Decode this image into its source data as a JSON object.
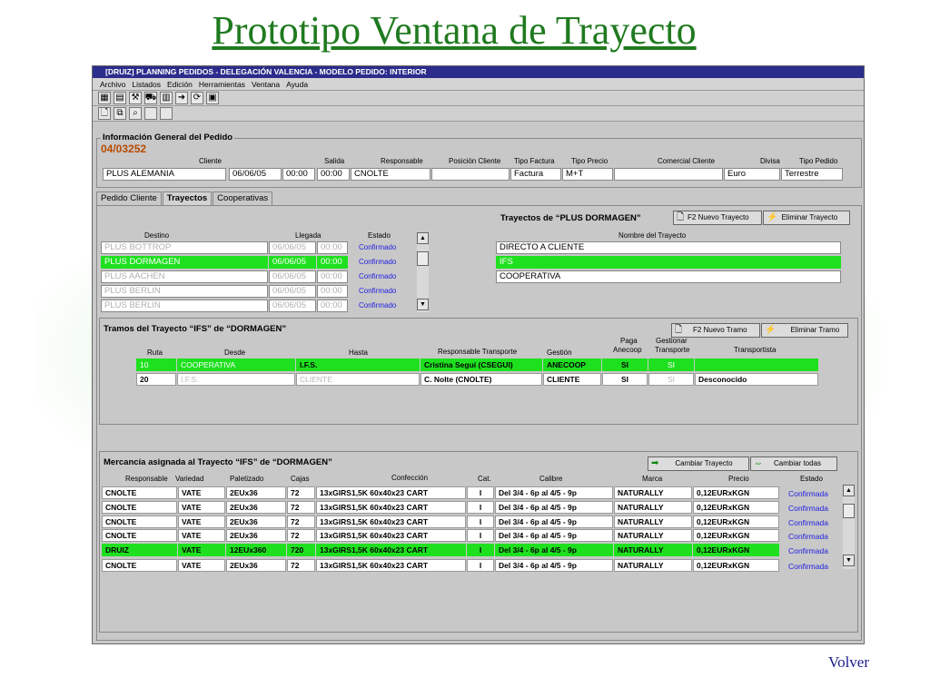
{
  "slide_title": "Prototipo Ventana de Trayecto",
  "volver": "Volver",
  "window": {
    "title": "[DRUIZ] PLANNING PEDIDOS - DELEGACIÓN VALENCIA - MODELO PEDIDO: INTERIOR",
    "menu": [
      "Archivo",
      "Listados",
      "Edición",
      "Herramientas",
      "Ventana",
      "Ayuda"
    ]
  },
  "info": {
    "title": "Información General del Pedido",
    "pedido": "04/03252",
    "headers": {
      "cliente": "Cliente",
      "salida": "Salida",
      "responsable": "Responsable",
      "posicion": "Posición Cliente",
      "tipo_factura": "Tipo Factura",
      "tipo_precio": "Tipo Precio",
      "comercial": "Comercial Cliente",
      "divisa": "Divisa",
      "tipo_pedido": "Tipo Pedido"
    },
    "values": {
      "cliente": "PLUS ALEMANIA",
      "fecha": "06/06/05",
      "hora1": "00:00",
      "hora2": "00:00",
      "responsable": "CNOLTE",
      "posicion": "",
      "tipo_factura": "Factura",
      "tipo_precio": "M+T",
      "comercial": "",
      "divisa": "Euro",
      "tipo_pedido": "Terrestre"
    }
  },
  "tabs": [
    "Pedido Cliente",
    "Trayectos",
    "Cooperativas"
  ],
  "destinos": {
    "headers": {
      "destino": "Destino",
      "llegada": "Llegada",
      "estado": "Estado"
    },
    "rows": [
      {
        "destino": "PLUS BOTTROP",
        "fecha": "06/06/05",
        "hora": "00:00",
        "estado": "Confirmado"
      },
      {
        "destino": "PLUS DORMAGEN",
        "fecha": "06/06/05",
        "hora": "00:00",
        "estado": "Confirmado"
      },
      {
        "destino": "PLUS AACHEN",
        "fecha": "06/06/05",
        "hora": "00:00",
        "estado": "Confirmado"
      },
      {
        "destino": "PLUS BERLIN",
        "fecha": "06/06/05",
        "hora": "00:00",
        "estado": "Confirmado"
      },
      {
        "destino": "PLUS BERLIN",
        "fecha": "06/06/05",
        "hora": "00:00",
        "estado": "Confirmado"
      }
    ]
  },
  "trayectos": {
    "title": "Trayectos de “PLUS DORMAGEN”",
    "nuevo": "F2 Nuevo Trayecto",
    "eliminar": "Eliminar Trayecto",
    "header": "Nombre del Trayecto",
    "rows": [
      "DIRECTO A CLIENTE",
      "IFS",
      "COOPERATIVA"
    ]
  },
  "tramos": {
    "title": "Tramos del Trayecto “IFS” de “DORMAGEN”",
    "nuevo": "F2 Nuevo Tramo",
    "eliminar": "Eliminar Tramo",
    "headers": {
      "ruta": "Ruta",
      "desde": "Desde",
      "hasta": "Hasta",
      "resp": "Responsable Transporte",
      "gestion": "Gestión",
      "paga1": "Paga",
      "paga2": "Anecoop",
      "gest1": "Gestionar",
      "gest2": "Transporte",
      "transportista": "Transportista"
    },
    "rows": [
      {
        "ruta": "10",
        "desde": "COOPERATIVA",
        "hasta": "I.F.S.",
        "resp": "Cristina Seguí (CSEGUI)",
        "gestion": "ANECOOP",
        "paga": "SI",
        "gestionar": "SI",
        "transportista": ""
      },
      {
        "ruta": "20",
        "desde": "I.F.S.",
        "hasta": "CLIENTE",
        "resp": "C. Nolte (CNOLTE)",
        "gestion": "CLIENTE",
        "paga": "SI",
        "gestionar": "SI",
        "transportista": "Desconocido"
      }
    ]
  },
  "mercancia": {
    "title": "Mercancía asignada al Trayecto “IFS”  de “DORMAGEN”",
    "cambiar": "Cambiar Trayecto",
    "cambiar_todas": "Cambiar todas",
    "headers": {
      "resp": "Responsable",
      "variedad": "Variedad",
      "paletizado": "Paletizado",
      "cajas": "Cajas",
      "confeccion": "Confección",
      "cat": "Cat.",
      "calibre": "Calibre",
      "marca": "Marca",
      "precio": "Precio",
      "estado": "Estado"
    },
    "rows": [
      {
        "resp": "CNOLTE",
        "variedad": "VATE",
        "paletizado": "2EUx36",
        "cajas": "72",
        "confeccion": "13xGIRS1,5K 60x40x23 CART",
        "cat": "I",
        "calibre": "Del 3/4 - 6p al 4/5 - 9p",
        "marca": "NATURALLY",
        "precio": "0,12EURxKGN",
        "estado": "Confirmada"
      },
      {
        "resp": "CNOLTE",
        "variedad": "VATE",
        "paletizado": "2EUx36",
        "cajas": "72",
        "confeccion": "13xGIRS1,5K 60x40x23 CART",
        "cat": "I",
        "calibre": "Del 3/4 - 6p al 4/5 - 9p",
        "marca": "NATURALLY",
        "precio": "0,12EURxKGN",
        "estado": "Confirmada"
      },
      {
        "resp": "CNOLTE",
        "variedad": "VATE",
        "paletizado": "2EUx36",
        "cajas": "72",
        "confeccion": "13xGIRS1,5K 60x40x23 CART",
        "cat": "I",
        "calibre": "Del 3/4 - 6p al 4/5 - 9p",
        "marca": "NATURALLY",
        "precio": "0,12EURxKGN",
        "estado": "Confirmada"
      },
      {
        "resp": "CNOLTE",
        "variedad": "VATE",
        "paletizado": "2EUx36",
        "cajas": "72",
        "confeccion": "13xGIRS1,5K 60x40x23 CART",
        "cat": "I",
        "calibre": "Del 3/4 - 6p al 4/5 - 9p",
        "marca": "NATURALLY",
        "precio": "0,12EURxKGN",
        "estado": "Confirmada"
      },
      {
        "resp": "DRUIZ",
        "variedad": "VATE",
        "paletizado": "12EUx360",
        "cajas": "720",
        "confeccion": "13xGIRS1,5K 60x40x23 CART",
        "cat": "I",
        "calibre": "Del 3/4 - 6p al 4/5 - 9p",
        "marca": "NATURALLY",
        "precio": "0,12EURxKGN",
        "estado": "Confirmada"
      },
      {
        "resp": "CNOLTE",
        "variedad": "VATE",
        "paletizado": "2EUx36",
        "cajas": "72",
        "confeccion": "13xGIRS1,5K 60x40x23 CART",
        "cat": "I",
        "calibre": "Del 3/4 - 6p al 4/5 - 9p",
        "marca": "NATURALLY",
        "precio": "0,12EURxKGN",
        "estado": "Confirmada"
      }
    ]
  },
  "colors": {
    "title_green": "#1f7a1f",
    "highlight_green": "#1fe01f",
    "estado_blue": "#1e1ee0"
  }
}
